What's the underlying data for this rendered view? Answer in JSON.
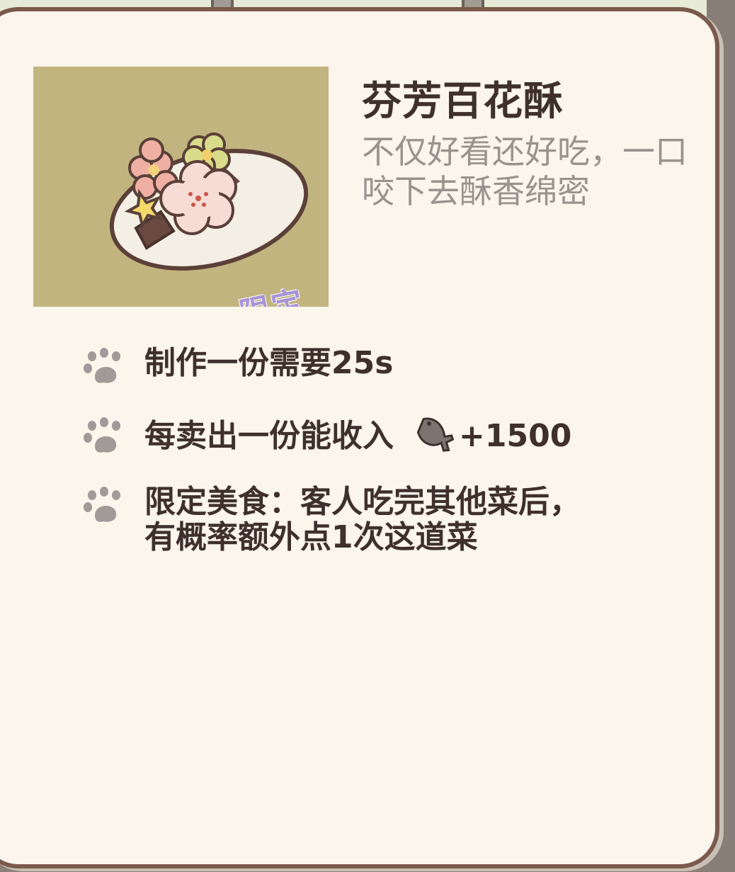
{
  "item": {
    "name": "芬芳百花酥",
    "description_lines": [
      "不仅好看还好吃，一口",
      "咬下去酥香绵密"
    ],
    "tag": "限定"
  },
  "details": [
    {
      "text": "制作一份需要25s"
    },
    {
      "text": "每卖出一份能收入",
      "reward_icon": "fish-icon",
      "reward_value": "+1500"
    },
    {
      "lines": [
        "限定美食：客人吃完其他菜后，",
        "有概率额外点1次这道菜"
      ]
    }
  ],
  "colors": {
    "card_bg": "#fbf5ec",
    "card_border": "#7a5a4c",
    "thumbnail_bg": "#c2b47f",
    "title": "#3f302c",
    "description": "#9a928c",
    "paw": "#a09a98",
    "tag": "#a894d6"
  }
}
